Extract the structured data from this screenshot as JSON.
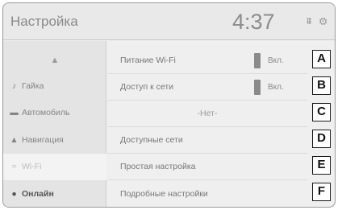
{
  "header": {
    "title": "Настройка",
    "clock": "4:37",
    "status_icons": "⩩ ⚙"
  },
  "sidebar": {
    "up_arrow": "▲",
    "items": [
      {
        "icon": "♪",
        "label": "Гайка"
      },
      {
        "icon": "▬",
        "label": "Автомобиль"
      },
      {
        "icon": "▲",
        "label": "Навигация"
      },
      {
        "icon": "≈",
        "label": "Wi-Fi"
      },
      {
        "icon": "●",
        "label": "Онлайн"
      }
    ]
  },
  "rows": [
    {
      "label": "Питание Wi-Fi",
      "value": "Вкл."
    },
    {
      "label": "Доступ к сети",
      "value": "Вкл."
    },
    {
      "center": "-Нет-"
    },
    {
      "label": "Доступные сети"
    },
    {
      "label": "Простая настройка"
    },
    {
      "label": "Подробные настройки"
    }
  ],
  "callouts": [
    "A",
    "B",
    "C",
    "D",
    "E",
    "F"
  ]
}
